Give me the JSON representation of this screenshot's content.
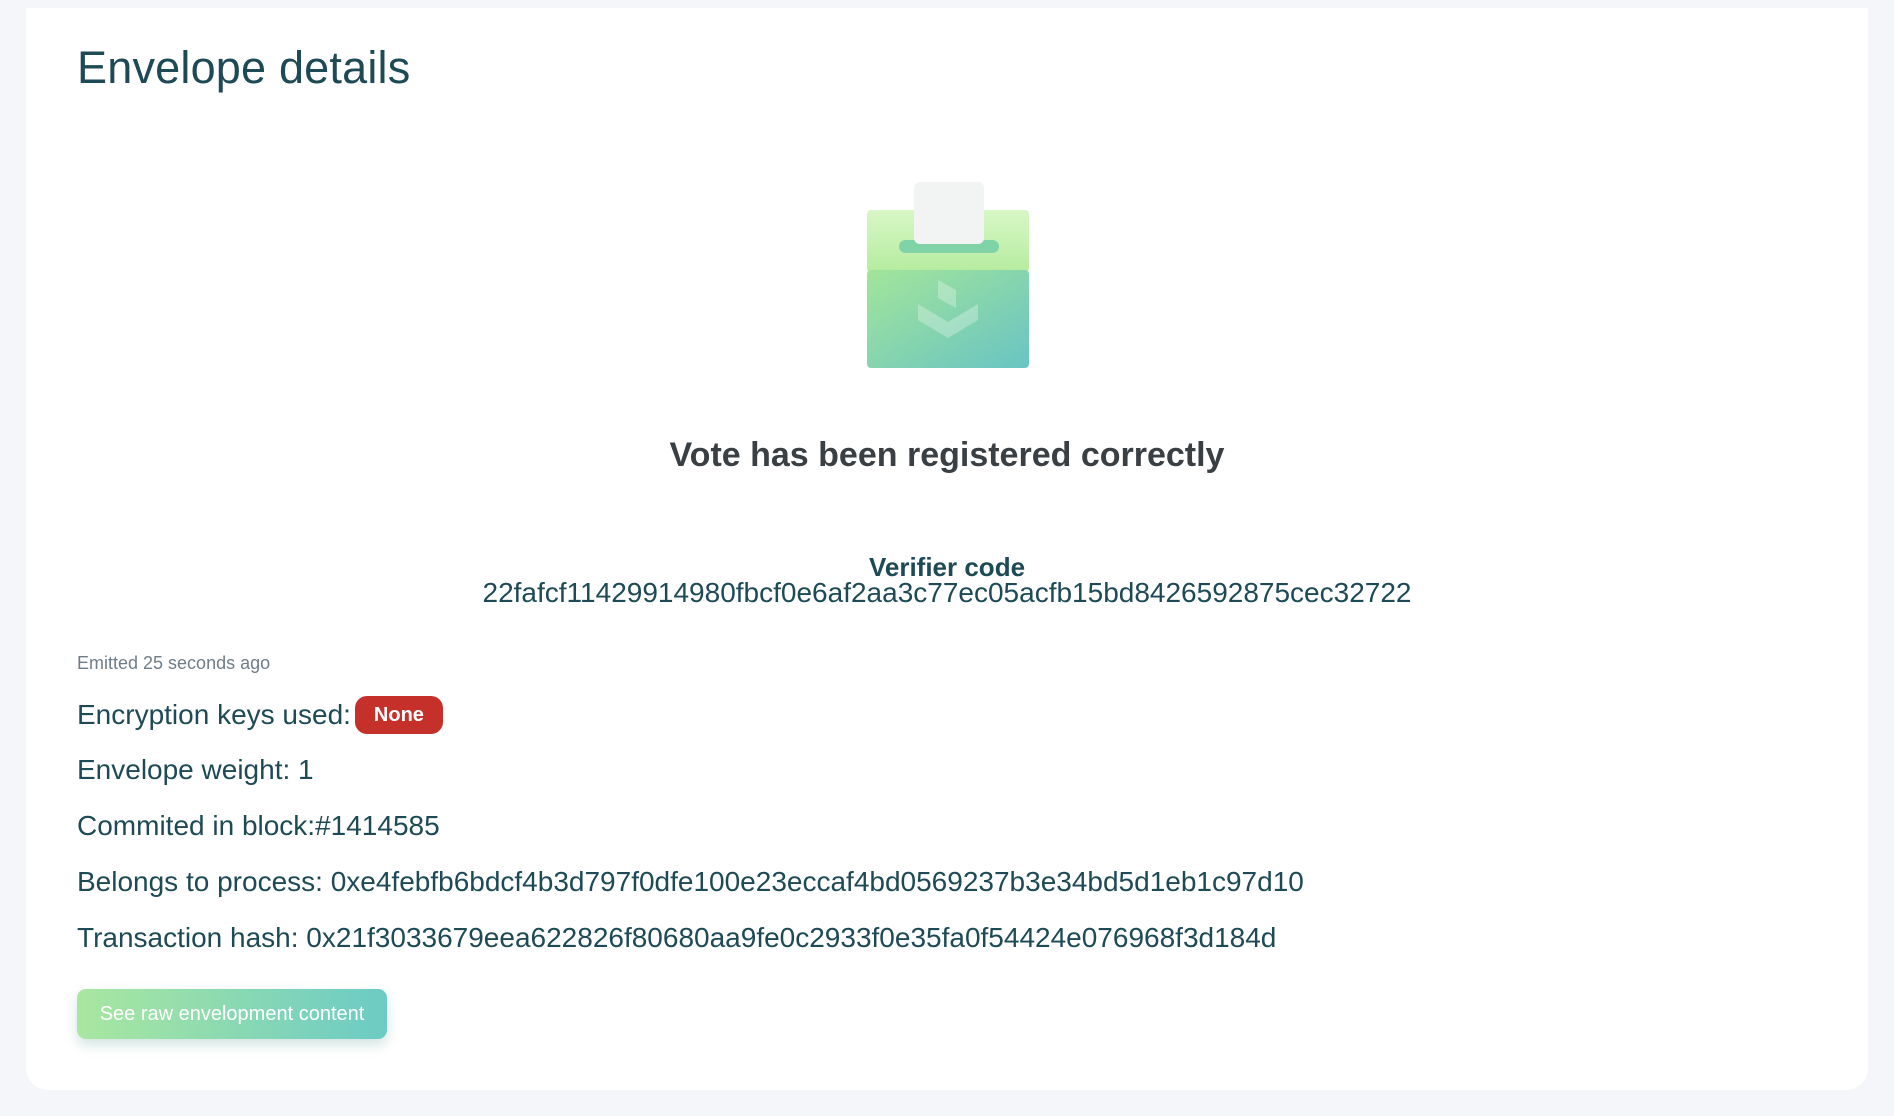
{
  "page": {
    "title": "Envelope details"
  },
  "status": {
    "headline": "Vote has been registered correctly"
  },
  "verifier": {
    "label": "Verifier code",
    "code": "22fafcf11429914980fbcf0e6af2aa3c77ec05acfb15bd8426592875cec32722"
  },
  "details": {
    "emitted": "Emitted 25 seconds ago",
    "encryption_label": "Encryption keys used:",
    "encryption_value": "None",
    "weight": "Envelope weight: 1",
    "block": "Commited in block:#1414585",
    "process": "Belongs to process: 0xe4febfb6bdcf4b3d797f0dfe100e23eccaf4bd0569237b3e34bd5d1eb1c97d10",
    "transaction": "Transaction hash: 0x21f3033679eea622826f80680aa9fe0c2933f0e35fa0f54424e076968f3d184d"
  },
  "actions": {
    "raw_button": "See raw envelopment content"
  },
  "icons": {
    "ballot": "ballot-box-icon"
  },
  "colors": {
    "badge_danger": "#c6302a",
    "button_gradient_start": "#a9e7a0",
    "button_gradient_end": "#6ccbc5",
    "heading": "#1e4a56"
  }
}
